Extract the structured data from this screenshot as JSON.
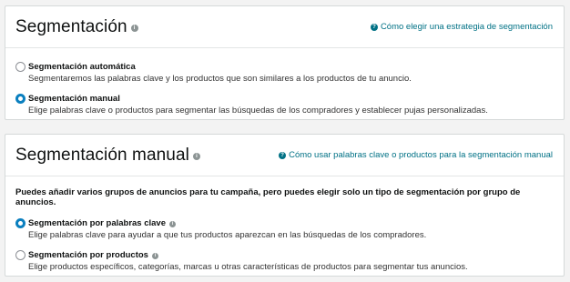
{
  "targeting": {
    "title": "Segmentación",
    "help_link": "Cómo elegir una estrategia de segmentación",
    "options": [
      {
        "label": "Segmentación automática",
        "description": "Segmentaremos las palabras clave y los productos que son similares a los productos de tu anuncio.",
        "selected": false
      },
      {
        "label": "Segmentación manual",
        "description": "Elige palabras clave o productos para segmentar las búsquedas de los compradores y establecer pujas personalizadas.",
        "selected": true
      }
    ]
  },
  "manual_targeting": {
    "title": "Segmentación manual",
    "help_link": "Cómo usar palabras clave o productos para la segmentación manual",
    "intro": "Puedes añadir varios grupos de anuncios para tu campaña, pero puedes elegir solo un tipo de segmentación por grupo de anuncios.",
    "options": [
      {
        "label": "Segmentación por palabras clave",
        "description": "Elige palabras clave para ayudar a que tus productos aparezcan en las búsquedas de los compradores.",
        "selected": true
      },
      {
        "label": "Segmentación por productos",
        "description": "Elige productos específicos, categorías, marcas u otras características de productos para segmentar tus anuncios.",
        "selected": false
      }
    ]
  },
  "icons": {
    "info": "info-icon",
    "help": "question-circle-icon"
  },
  "colors": {
    "link": "#007185",
    "radio_selected": "#0a7fbf",
    "page_bg": "#f3f3f3"
  }
}
